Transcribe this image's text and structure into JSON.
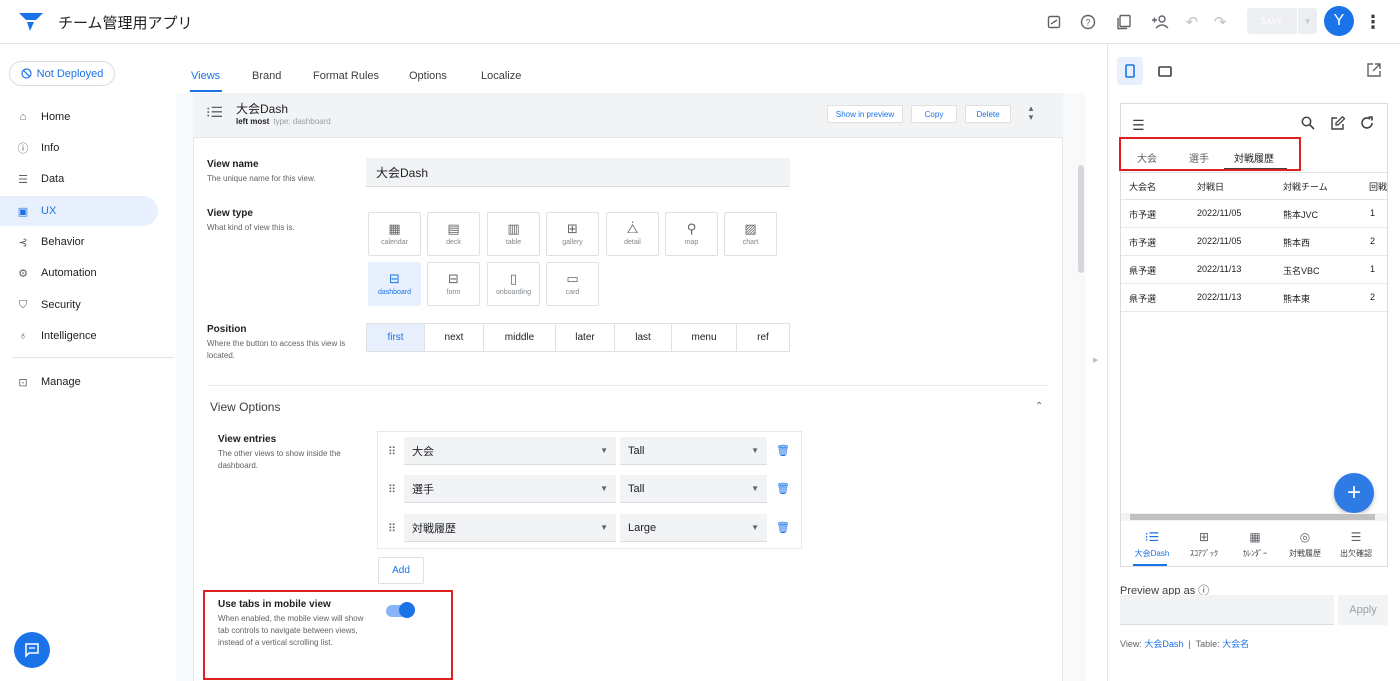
{
  "app": {
    "title": "チーム管理用アプリ",
    "save_label": "SAVE",
    "avatar_letter": "Y"
  },
  "colors": {
    "accent": "#1a73e8",
    "highlight_border": "#e02020",
    "active_bg": "#e8f0fe"
  },
  "sidebar": {
    "deploy_status": "Not Deployed",
    "items": [
      {
        "label": "Home",
        "icon": "home-icon"
      },
      {
        "label": "Info",
        "icon": "info-icon"
      },
      {
        "label": "Data",
        "icon": "data-icon"
      },
      {
        "label": "UX",
        "icon": "ux-icon",
        "active": true
      },
      {
        "label": "Behavior",
        "icon": "behavior-icon"
      },
      {
        "label": "Automation",
        "icon": "automation-icon"
      },
      {
        "label": "Security",
        "icon": "shield-icon"
      },
      {
        "label": "Intelligence",
        "icon": "lightbulb-icon"
      },
      {
        "label": "Manage",
        "icon": "manage-icon"
      }
    ]
  },
  "tabs": [
    "Views",
    "Brand",
    "Format Rules",
    "Options",
    "Localize"
  ],
  "view": {
    "title": "大会Dash",
    "position_label": "left most",
    "type_label": "type: dashboard",
    "buttons": {
      "preview": "Show in preview",
      "copy": "Copy",
      "delete": "Delete"
    }
  },
  "fields": {
    "view_name": {
      "label": "View name",
      "desc": "The unique name for this view.",
      "value": "大会Dash"
    },
    "view_type": {
      "label": "View type",
      "desc": "What kind of view this is.",
      "options": [
        "calendar",
        "deck",
        "table",
        "gallery",
        "detail",
        "map",
        "chart",
        "dashboard",
        "form",
        "onboarding",
        "card"
      ],
      "selected": "dashboard"
    },
    "position": {
      "label": "Position",
      "desc": "Where the button to access this view is located.",
      "options": [
        "first",
        "next",
        "middle",
        "later",
        "last",
        "menu",
        "ref"
      ],
      "selected": "first"
    }
  },
  "view_options": {
    "title": "View Options",
    "entries_label": "View entries",
    "entries_desc": "The other views to show inside the dashboard.",
    "entries": [
      {
        "view": "大会",
        "size": "Tall"
      },
      {
        "view": "選手",
        "size": "Tall"
      },
      {
        "view": "対戦履歴",
        "size": "Large"
      }
    ],
    "add_label": "Add",
    "tabs_toggle": {
      "label": "Use tabs in mobile view",
      "desc": "When enabled, the mobile view will show tab controls to navigate between views, instead of a vertical scrolling list.",
      "enabled": true
    }
  },
  "preview": {
    "tabs": [
      "大会",
      "選手",
      "対戦履歴"
    ],
    "active_tab": "対戦履歴",
    "columns": [
      "大会名",
      "対戦日",
      "対戦チーム",
      "回戦"
    ],
    "rows": [
      [
        "市予選",
        "2022/11/05",
        "熊本JVC",
        "1"
      ],
      [
        "市予選",
        "2022/11/05",
        "熊本西",
        "2"
      ],
      [
        "県予選",
        "2022/11/13",
        "玉名VBC",
        "1"
      ],
      [
        "県予選",
        "2022/11/13",
        "熊本東",
        "2"
      ]
    ],
    "bottom_nav": [
      {
        "label": "大会Dash",
        "icon": "list-icon",
        "active": true
      },
      {
        "label": "ｽｺｱﾌﾞｯｸ",
        "icon": "table-icon"
      },
      {
        "label": "ｶﾚﾝﾀﾞｰ",
        "icon": "calendar-icon"
      },
      {
        "label": "対戦履歴",
        "icon": "volleyball-icon"
      },
      {
        "label": "出欠確認",
        "icon": "checklist-icon"
      }
    ],
    "preview_as_label": "Preview app as",
    "apply_label": "Apply",
    "footer": {
      "view_prefix": "View:",
      "view_value": "大会Dash",
      "separator": "|",
      "table_prefix": "Table:",
      "table_value": "大会名"
    }
  }
}
